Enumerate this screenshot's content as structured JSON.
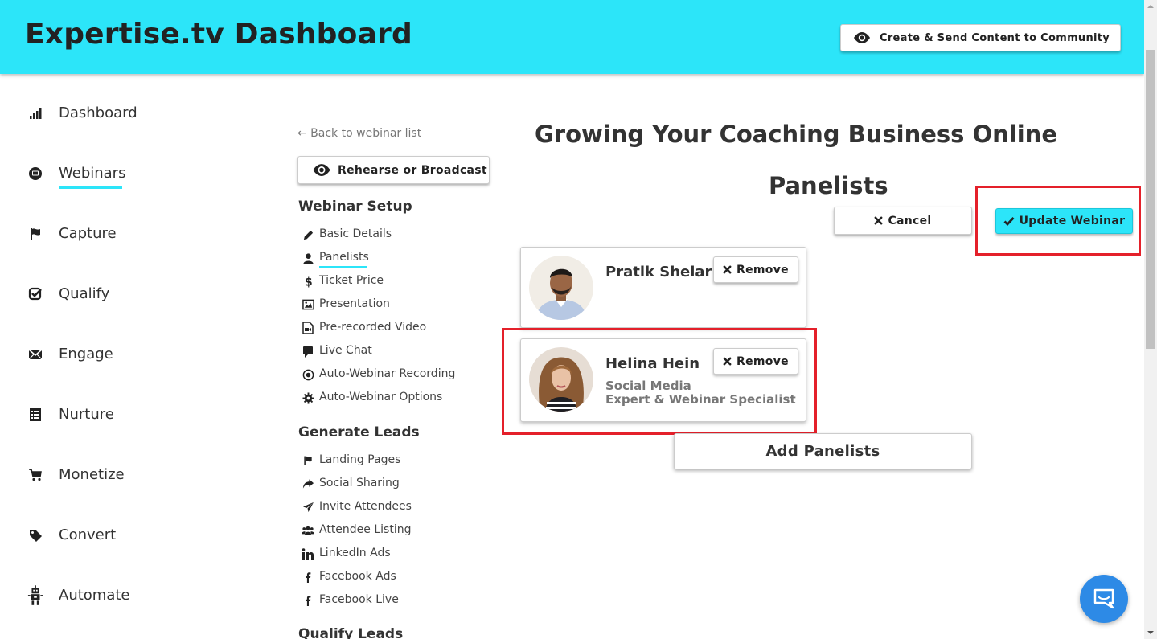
{
  "header": {
    "title": "Expertise.tv Dashboard",
    "community_button": "Create & Send Content to Community"
  },
  "sidebar": {
    "active": "Webinars",
    "items": [
      {
        "label": "Dashboard",
        "icon": "bar-chart-icon"
      },
      {
        "label": "Webinars",
        "icon": "webinar-icon"
      },
      {
        "label": "Capture",
        "icon": "flag-icon"
      },
      {
        "label": "Qualify",
        "icon": "check-square-icon"
      },
      {
        "label": "Engage",
        "icon": "envelope-icon"
      },
      {
        "label": "Nurture",
        "icon": "list-icon"
      },
      {
        "label": "Monetize",
        "icon": "cart-icon"
      },
      {
        "label": "Convert",
        "icon": "tag-icon"
      },
      {
        "label": "Automate",
        "icon": "robot-icon"
      }
    ]
  },
  "setup": {
    "back_link": "← Back to webinar list",
    "rehearse_button": "Rehearse or Broadcast",
    "webinar_setup_heading": "Webinar Setup",
    "webinar_setup_items": [
      {
        "label": "Basic Details",
        "icon": "pencil-icon"
      },
      {
        "label": "Panelists",
        "icon": "user-icon"
      },
      {
        "label": "Ticket Price",
        "icon": "dollar-icon"
      },
      {
        "label": "Presentation",
        "icon": "picture-icon"
      },
      {
        "label": "Pre-recorded Video",
        "icon": "video-file-icon"
      },
      {
        "label": "Live Chat",
        "icon": "comment-icon"
      },
      {
        "label": "Auto-Webinar Recording",
        "icon": "record-icon"
      },
      {
        "label": "Auto-Webinar Options",
        "icon": "gear-icon"
      }
    ],
    "active_item": "Panelists",
    "generate_leads_heading": "Generate Leads",
    "generate_leads_items": [
      {
        "label": "Landing Pages",
        "icon": "flag-icon"
      },
      {
        "label": "Social Sharing",
        "icon": "share-icon"
      },
      {
        "label": "Invite Attendees",
        "icon": "paper-plane-icon"
      },
      {
        "label": "Attendee Listing",
        "icon": "users-icon"
      },
      {
        "label": "LinkedIn Ads",
        "icon": "linkedin-icon"
      },
      {
        "label": "Facebook Ads",
        "icon": "facebook-icon"
      },
      {
        "label": "Facebook Live",
        "icon": "facebook-icon"
      }
    ],
    "qualify_leads_heading": "Qualify Leads"
  },
  "main": {
    "webinar_title": "Growing Your Coaching Business Online",
    "section_title": "Panelists",
    "cancel_button": "Cancel",
    "update_button": "Update Webinar",
    "remove_label": "Remove",
    "add_button": "Add Panelists",
    "panelists": [
      {
        "name": "Pratik Shelar",
        "title_line1": "",
        "title_line2": ""
      },
      {
        "name": "Helina Hein",
        "title_line1": "Social Media",
        "title_line2": "Expert & Webinar Specialist"
      }
    ]
  },
  "colors": {
    "accent": "#2ce5f9",
    "highlight": "#e4202a",
    "chat": "#2d8ae6"
  }
}
